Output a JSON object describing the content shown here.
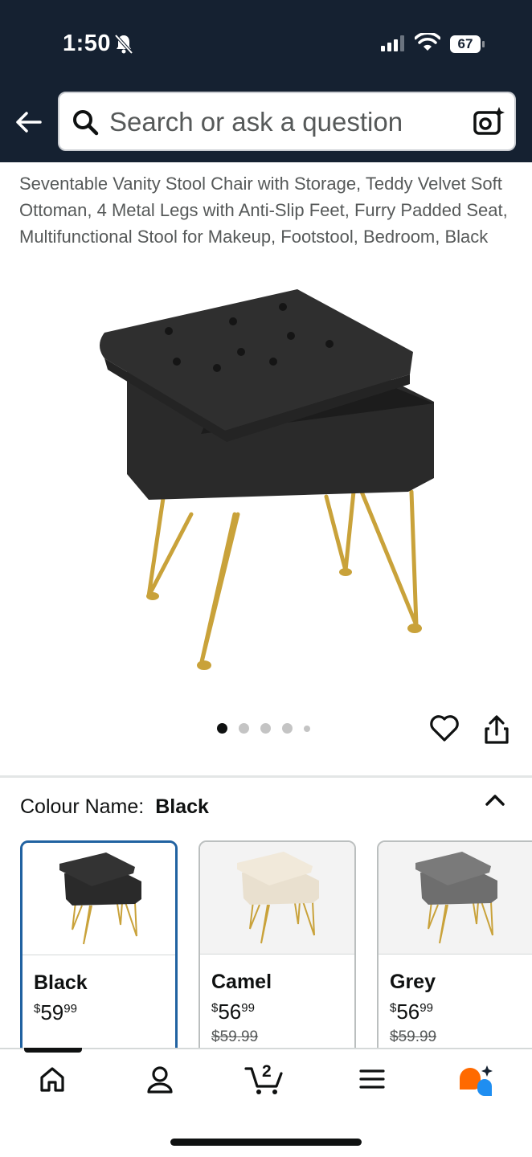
{
  "status_bar": {
    "time": "1:50",
    "battery": "67"
  },
  "search": {
    "placeholder": "Search or ask a question"
  },
  "product": {
    "title": "Seventable Vanity Stool Chair with Storage, Teddy Velvet Soft Ottoman, 4 Metal Legs with Anti-Slip Feet, Furry Padded Seat, Multifunctional Stool for Makeup, Footstool, Bedroom, Black",
    "image_count": 5,
    "active_image": 1
  },
  "colour": {
    "label": "Colour Name:",
    "selected": "Black"
  },
  "swatches": [
    {
      "name": "Black",
      "currency": "$",
      "price_whole": "59",
      "price_fraction": "99",
      "was": ""
    },
    {
      "name": "Camel",
      "currency": "$",
      "price_whole": "56",
      "price_fraction": "99",
      "was": "$59.99"
    },
    {
      "name": "Grey",
      "currency": "$",
      "price_whole": "56",
      "price_fraction": "99",
      "was": "$59.99"
    }
  ],
  "nav": {
    "cart_count": "2"
  },
  "colors": {
    "header": "#152131",
    "selected_border": "#2162a1",
    "stool_black": "#2a2a2a",
    "stool_camel": "#e9e0cf",
    "stool_grey": "#6e6e6e",
    "legs_gold": "#c9a23a"
  }
}
